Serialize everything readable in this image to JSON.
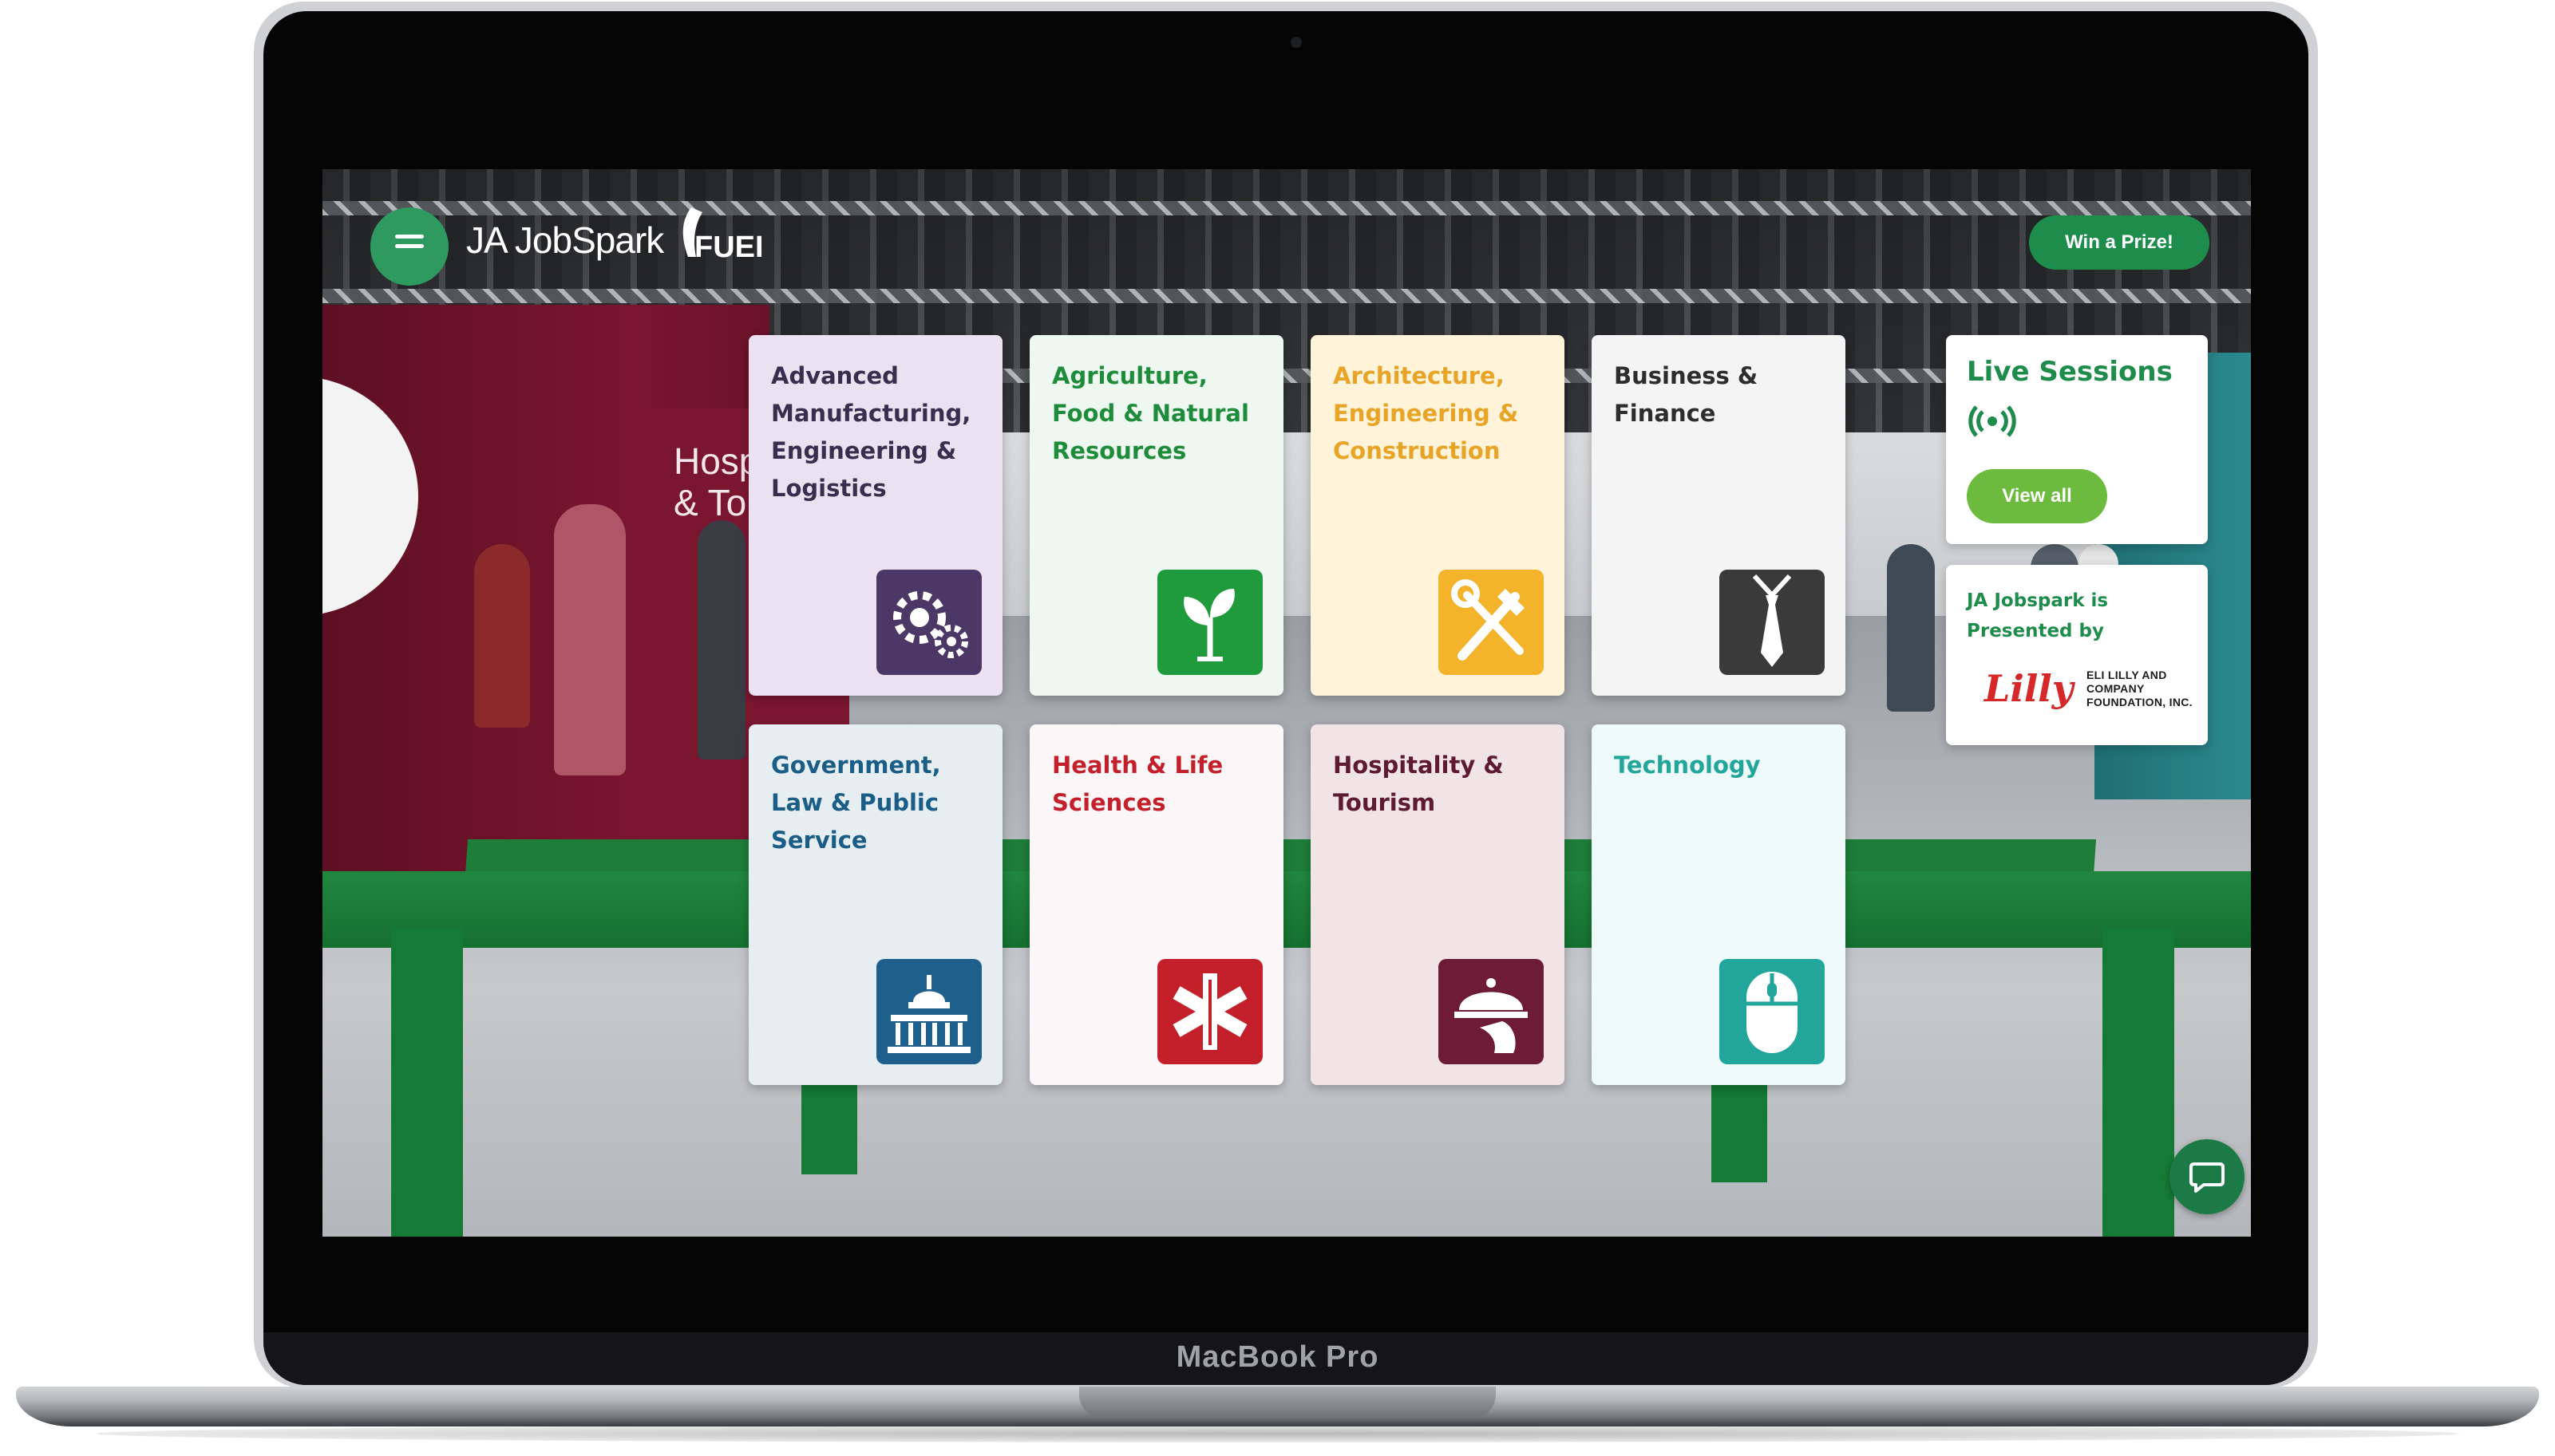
{
  "device": {
    "model_label": "MacBook Pro"
  },
  "header": {
    "logo_text": "JA JobSpark",
    "partner_logo_text": "FUEL",
    "prize_button_label": "Win a Prize!"
  },
  "scene": {
    "booth_sign": "Hospita\n& Tou"
  },
  "categories": [
    {
      "title": "Advanced Manufacturing, Engineering & Logistics",
      "color": "#3a2d4e",
      "card_bg": "#ece1f1",
      "icon": "gears-icon",
      "tile_color": "#4b3866"
    },
    {
      "title": "Agriculture, Food & Natural Resources",
      "color": "#1e8c3a",
      "card_bg": "#eef8f1",
      "icon": "plant-icon",
      "tile_color": "#1f9a3c"
    },
    {
      "title": "Architecture, Engineering & Construction",
      "color": "#e8a426",
      "card_bg": "#fff4d9",
      "icon": "tools-icon",
      "tile_color": "#f3b32b"
    },
    {
      "title": "Business & Finance",
      "color": "#2d2d2d",
      "card_bg": "#f4f4f4",
      "icon": "tie-icon",
      "tile_color": "#3a3a3a"
    },
    {
      "title": "Government, Law & Public Service",
      "color": "#1a5d86",
      "card_bg": "#e6eef2",
      "icon": "capitol-icon",
      "tile_color": "#1f5f8c"
    },
    {
      "title": "Health & Life Sciences",
      "color": "#c4202b",
      "card_bg": "#fbf7f8",
      "icon": "medical-icon",
      "tile_color": "#c4202b"
    },
    {
      "title": "Hospitality & Tourism",
      "color": "#5e1a33",
      "card_bg": "#f0e4e7",
      "icon": "cloche-icon",
      "tile_color": "#6d1b37"
    },
    {
      "title": "Technology",
      "color": "#22a59a",
      "card_bg": "#eefaf9",
      "icon": "mouse-icon",
      "tile_color": "#22a59a"
    }
  ],
  "live_sessions": {
    "title": "Live Sessions",
    "icon": "broadcast-icon",
    "button_label": "View all"
  },
  "sponsor": {
    "text": "JA Jobspark is Presented by",
    "logo_script": "Lilly",
    "logo_small": "ELI LILLY AND COMPANY FOUNDATION, INC."
  },
  "chat": {
    "icon": "chat-icon"
  }
}
